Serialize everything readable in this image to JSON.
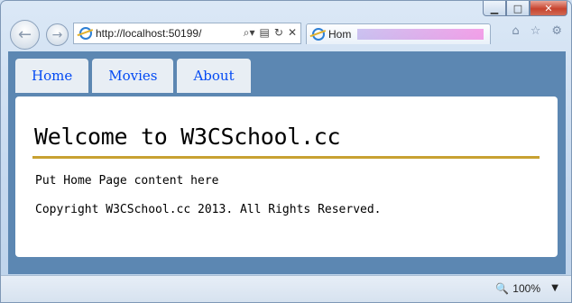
{
  "browser": {
    "address": "http://localhost:50199/",
    "tab_title": "Hom",
    "zoom": "100%",
    "icons": [
      "back-icon",
      "forward-icon",
      "ie-icon",
      "search-icon",
      "compat-icon",
      "refresh-icon",
      "stop-icon",
      "home-icon",
      "favorites-icon",
      "tools-icon",
      "zoom-icon"
    ]
  },
  "site": {
    "nav": [
      "Home",
      "Movies",
      "About"
    ],
    "heading": "Welcome to W3CSchool.cc",
    "body": "Put Home Page content here",
    "footer": "Copyright W3CSchool.cc 2013. All Rights Reserved."
  },
  "colors": {
    "page_bg": "#5c87b2",
    "nav_link": "#034af3",
    "rule": "#c8a131"
  }
}
